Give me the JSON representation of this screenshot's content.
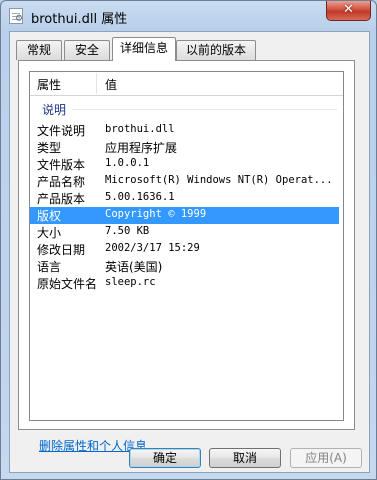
{
  "window": {
    "title": "brothui.dll 属性",
    "close_glyph": "✕",
    "icon": "dll-file-icon"
  },
  "tabs": [
    "常规",
    "安全",
    "详细信息",
    "以前的版本"
  ],
  "active_tab": 2,
  "details": {
    "col_property": "属性",
    "col_value": "值",
    "group_label": "说明",
    "rows": [
      {
        "name": "文件说明",
        "value": "brothui.dll"
      },
      {
        "name": "类型",
        "value": "应用程序扩展"
      },
      {
        "name": "文件版本",
        "value": "1.0.0.1"
      },
      {
        "name": "产品名称",
        "value": "Microsoft(R) Windows NT(R) Operat..."
      },
      {
        "name": "产品版本",
        "value": "5.00.1636.1"
      },
      {
        "name": "版权",
        "value": "Copyright © 1999"
      },
      {
        "name": "大小",
        "value": "7.50 KB"
      },
      {
        "name": "修改日期",
        "value": "2002/3/17 15:29"
      },
      {
        "name": "语言",
        "value": "英语(美国)"
      },
      {
        "name": "原始文件名",
        "value": "sleep.rc"
      }
    ],
    "selected_row": 5
  },
  "remove_link": "删除属性和个人信息",
  "buttons": {
    "ok": "确定",
    "cancel": "取消",
    "apply": "应用(A)"
  },
  "colors": {
    "selection": "#3399ff",
    "link": "#0066cc",
    "group_label": "#1e3287",
    "close_button": "#c0392b"
  }
}
